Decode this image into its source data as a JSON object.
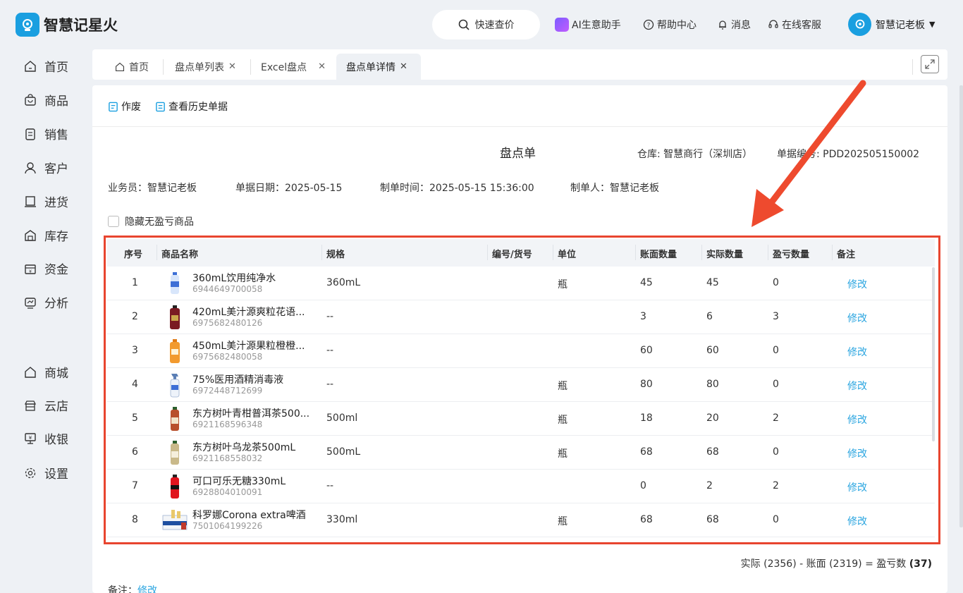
{
  "app": {
    "name": "智慧记星火",
    "quick_search": "快速查价",
    "ai_assistant": "AI生意助手",
    "help": "帮助中心",
    "messages": "消息",
    "support": "在线客服",
    "user": "智慧记老板"
  },
  "sidebar": {
    "items": [
      {
        "label": "首页",
        "icon": "home-icon"
      },
      {
        "label": "商品",
        "icon": "bag-icon"
      },
      {
        "label": "销售",
        "icon": "clipboard-icon"
      },
      {
        "label": "客户",
        "icon": "user-icon"
      },
      {
        "label": "进货",
        "icon": "cart-icon"
      },
      {
        "label": "库存",
        "icon": "warehouse-icon"
      },
      {
        "label": "资金",
        "icon": "wallet-icon"
      },
      {
        "label": "分析",
        "icon": "chart-icon"
      }
    ],
    "items2": [
      {
        "label": "商城",
        "icon": "shop-icon"
      },
      {
        "label": "云店",
        "icon": "store-icon"
      },
      {
        "label": "收银",
        "icon": "pos-icon"
      },
      {
        "label": "设置",
        "icon": "settings-icon"
      }
    ]
  },
  "tabs": [
    {
      "label": "首页"
    },
    {
      "label": "盘点单列表"
    },
    {
      "label": "Excel盘点"
    },
    {
      "label": "盘点单详情"
    }
  ],
  "toolbar": {
    "void_label": "作废",
    "history_label": "查看历史单据"
  },
  "doc": {
    "title": "盘点单",
    "warehouse": "仓库: 智慧商行（深圳店）",
    "doc_no": "单据编号: PDD202505150002",
    "salesperson": "业务员：智慧记老板",
    "doc_date": "单据日期：2025-05-15",
    "created_time": "制单时间：2025-05-15 15:36:00",
    "creator": "制单人：智慧记老板",
    "hide_label": "隐藏无盈亏商品"
  },
  "table": {
    "headers": [
      "序号",
      "商品名称",
      "规格",
      "编号/货号",
      "单位",
      "账面数量",
      "实际数量",
      "盈亏数量",
      "备注"
    ],
    "rows": [
      {
        "no": "1",
        "name": "360mL饮用纯净水",
        "code": "6944649700058",
        "spec": "360mL",
        "sku": "",
        "unit": "瓶",
        "book": "45",
        "actual": "45",
        "diff": "0",
        "action": "修改"
      },
      {
        "no": "2",
        "name": "420mL美汁源爽粒花语...",
        "code": "6975682480126",
        "spec": "--",
        "sku": "",
        "unit": "",
        "book": "3",
        "actual": "6",
        "diff": "3",
        "action": "修改"
      },
      {
        "no": "3",
        "name": "450mL美汁源果粒橙橙...",
        "code": "6975682480058",
        "spec": "--",
        "sku": "",
        "unit": "",
        "book": "60",
        "actual": "60",
        "diff": "0",
        "action": "修改"
      },
      {
        "no": "4",
        "name": "75%医用酒精消毒液",
        "code": "6972448712699",
        "spec": "--",
        "sku": "",
        "unit": "瓶",
        "book": "80",
        "actual": "80",
        "diff": "0",
        "action": "修改"
      },
      {
        "no": "5",
        "name": "东方树叶青柑普洱茶500...",
        "code": "6921168596348",
        "spec": "500ml",
        "sku": "",
        "unit": "瓶",
        "book": "18",
        "actual": "20",
        "diff": "2",
        "action": "修改"
      },
      {
        "no": "6",
        "name": "东方树叶乌龙茶500mL",
        "code": "6921168558032",
        "spec": "500mL",
        "sku": "",
        "unit": "瓶",
        "book": "68",
        "actual": "68",
        "diff": "0",
        "action": "修改"
      },
      {
        "no": "7",
        "name": "可口可乐无糖330mL",
        "code": "6928804010091",
        "spec": "--",
        "sku": "",
        "unit": "",
        "book": "0",
        "actual": "2",
        "diff": "2",
        "action": "修改"
      },
      {
        "no": "8",
        "name": "科罗娜Corona extra啤酒",
        "code": "7501064199226",
        "spec": "330ml",
        "sku": "",
        "unit": "瓶",
        "book": "68",
        "actual": "68",
        "diff": "0",
        "action": "修改"
      }
    ]
  },
  "summary": {
    "text": "实际 (2356) - 账面 (2319) = 盈亏数 ",
    "total": "(37)"
  },
  "remark": {
    "label": "备注：",
    "link": "修改"
  },
  "colors": {
    "accent": "#1a9fe0",
    "link": "#2aa5e0",
    "highlight": "#e8452f"
  }
}
